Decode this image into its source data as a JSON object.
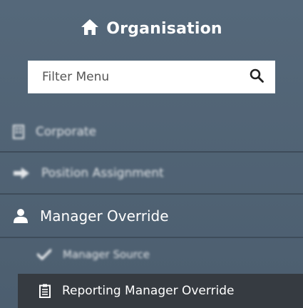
{
  "header": {
    "title": "Organisation",
    "icon": "home-icon"
  },
  "filter": {
    "placeholder": "Filter Menu",
    "icon": "search-icon"
  },
  "menu": {
    "corporate": {
      "label": "Corporate",
      "icon": "building-icon"
    },
    "position_assignment": {
      "label": "Position Assignment",
      "icon": "arrow-right-icon"
    },
    "manager_override": {
      "label": "Manager Override",
      "icon": "user-icon"
    },
    "manager_source": {
      "label": "Manager Source",
      "icon": "check-icon"
    },
    "reporting_manager_override": {
      "label": "Reporting Manager Override",
      "icon": "clipboard-icon",
      "active": true
    }
  },
  "colors": {
    "panel_bg": "#4f6172",
    "active_bg": "#363b41",
    "text": "#ffffff",
    "divider": "#3e4c5a"
  }
}
